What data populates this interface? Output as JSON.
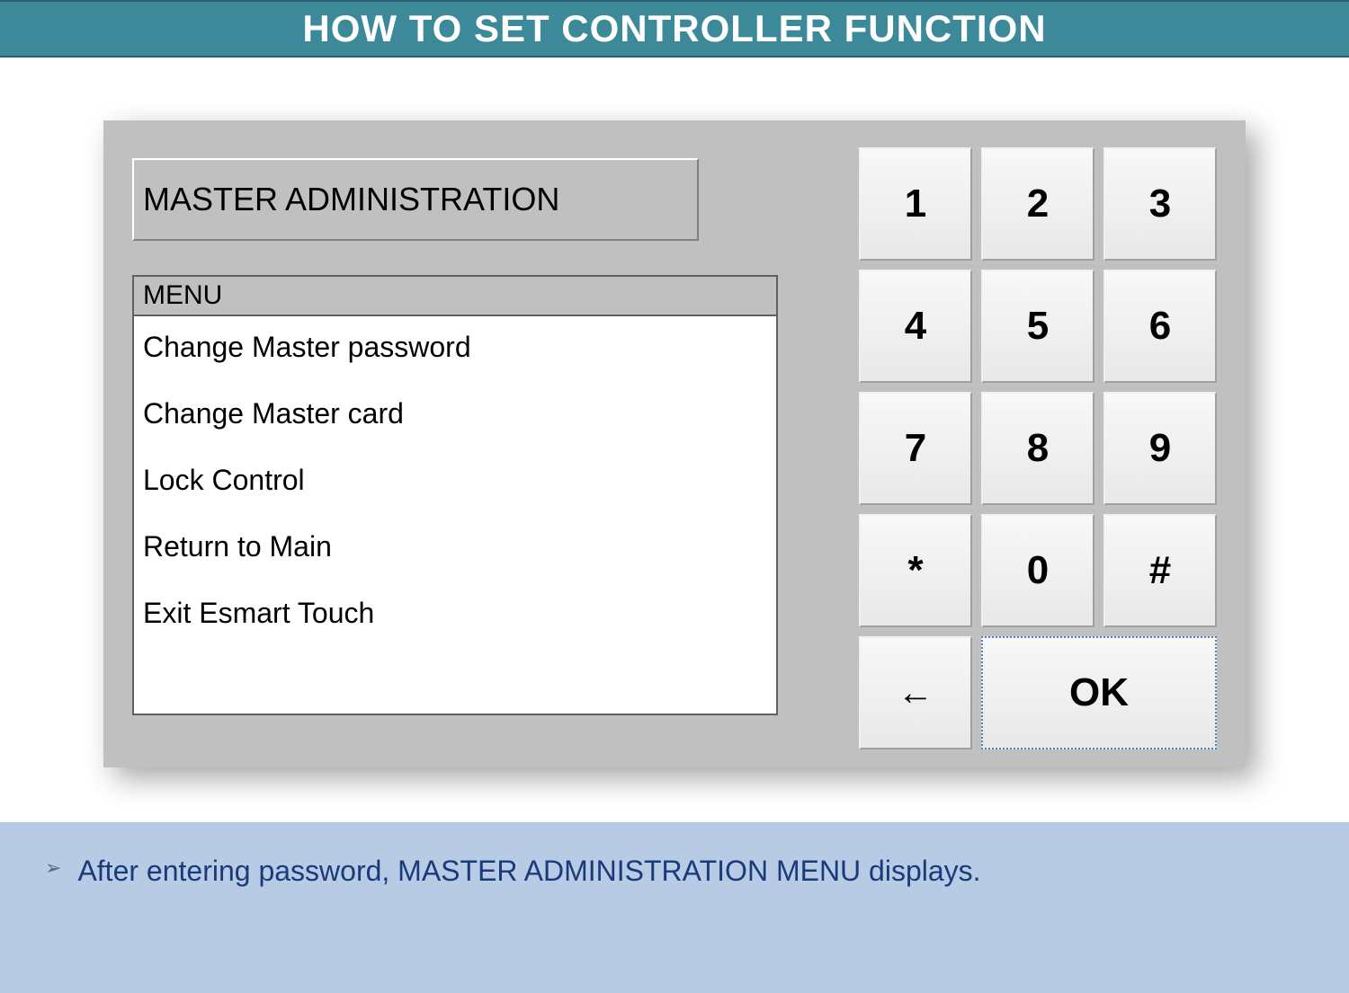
{
  "header": {
    "title": "HOW TO SET CONTROLLER FUNCTION"
  },
  "panel": {
    "title": "MASTER ADMINISTRATION",
    "menu_header": "MENU",
    "menu_items": [
      "Change Master password",
      "Change Master card",
      "Lock Control",
      "Return to Main",
      "Exit Esmart Touch"
    ]
  },
  "keypad": {
    "keys": [
      "1",
      "2",
      "3",
      "4",
      "5",
      "6",
      "7",
      "8",
      "9",
      "*",
      "0",
      "#"
    ],
    "back_label": "←",
    "ok_label": "OK"
  },
  "footer": {
    "bullet": "➢",
    "text": "After entering password, MASTER ADMINISTRATION MENU displays."
  }
}
